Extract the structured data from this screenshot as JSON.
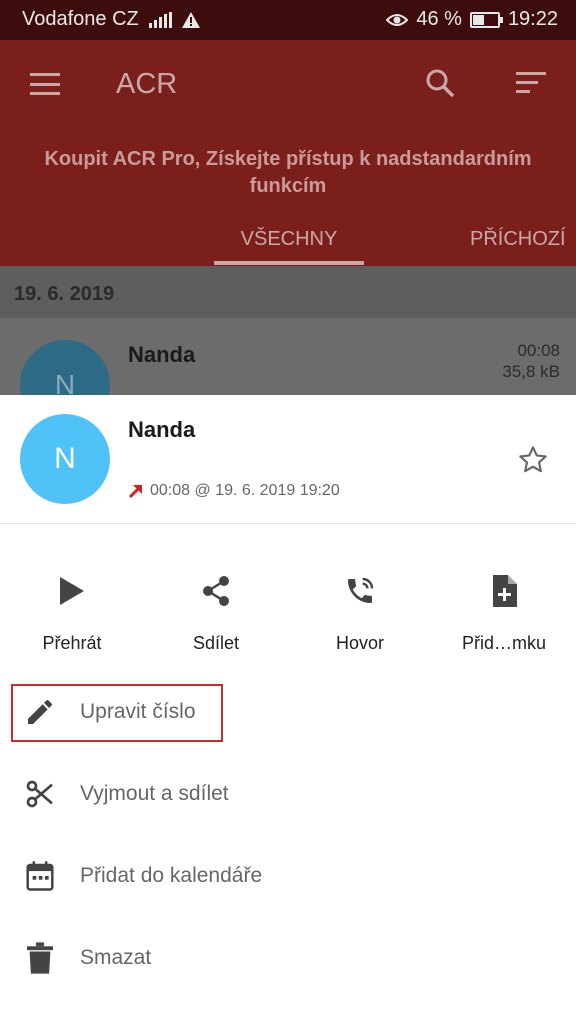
{
  "status_bar": {
    "carrier": "Vodafone CZ",
    "battery_percent": "46 %",
    "battery_level": 0.46,
    "time": "19:22",
    "icons": [
      "signal-icon",
      "warning-icon",
      "eye-icon",
      "battery-icon"
    ]
  },
  "app_bar": {
    "title": "ACR",
    "promo_text": "Koupit ACR Pro, Získejte přístup k nadstandardním funkcím",
    "tabs": [
      {
        "label": "VŠECHNY",
        "selected": true
      },
      {
        "label": "PŘÍCHOZÍ",
        "selected": false
      }
    ],
    "icons": [
      "menu-icon",
      "search-icon",
      "sort-icon"
    ],
    "color": "#7b1f1d"
  },
  "list": {
    "date_header": "19. 6. 2019",
    "items": [
      {
        "avatar_letter": "N",
        "name": "Nanda",
        "duration": "00:08",
        "size": "35,8 kB"
      }
    ]
  },
  "sheet": {
    "avatar_letter": "N",
    "avatar_color": "#4fc3f7",
    "name": "Nanda",
    "call_info": "00:08 @ 19. 6. 2019 19:20",
    "call_direction_icon": "outgoing-call-icon",
    "actions": [
      {
        "label": "Přehrát",
        "icon": "play-icon"
      },
      {
        "label": "Sdílet",
        "icon": "share-icon"
      },
      {
        "label": "Hovor",
        "icon": "phone-icon"
      },
      {
        "label": "Přid…mku",
        "icon": "note-add-icon"
      }
    ],
    "menu": [
      {
        "label": "Upravit číslo",
        "icon": "edit-icon",
        "highlighted": true
      },
      {
        "label": "Vyjmout a sdílet",
        "icon": "cut-icon"
      },
      {
        "label": "Přidat do kalendáře",
        "icon": "calendar-icon"
      },
      {
        "label": "Smazat",
        "icon": "delete-icon"
      }
    ],
    "highlight_color": "#d02b2b"
  }
}
